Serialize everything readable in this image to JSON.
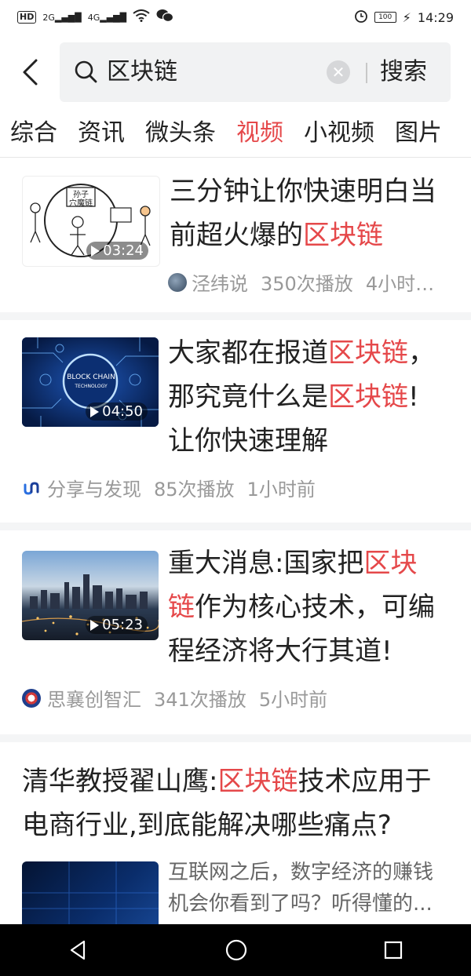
{
  "status_bar": {
    "hd": "HD",
    "net1": "2G",
    "net2": "4G",
    "battery": "100",
    "time": "14:29"
  },
  "search": {
    "query": "区块链",
    "button": "搜索"
  },
  "tabs": [
    {
      "label": "综合"
    },
    {
      "label": "资讯"
    },
    {
      "label": "微头条"
    },
    {
      "label": "视频"
    },
    {
      "label": "小视频"
    },
    {
      "label": "图片"
    }
  ],
  "results": [
    {
      "title_pre": "三分钟让你快速明白当前超火爆的",
      "title_hl": "区块链",
      "duration": "03:24",
      "author": "泾纬说",
      "plays": "350次播放",
      "time": "4小时…",
      "thumb_text": "孙子\n穴魔链"
    },
    {
      "title_pre": "大家都在报道",
      "title_hl": "区块链",
      "title_mid": "，那究竟什么是",
      "title_hl2": "区块链",
      "title_post": "!让你快速理解",
      "duration": "04:50",
      "author": "分享与发现",
      "plays": "85次播放",
      "time": "1小时前",
      "thumb_text": "BLOCK CHAIN",
      "thumb_sub": "TECHNOLOGY"
    },
    {
      "title_pre": "重大消息:国家把",
      "title_hl": "区块链",
      "title_post": "作为核心技术，可编程经济将大行其道!",
      "duration": "05:23",
      "author": "思襄创智汇",
      "plays": "341次播放",
      "time": "5小时前"
    },
    {
      "title_pre": "清华教授翟山鹰:",
      "title_hl": "区块链",
      "title_post": "技术应用于电商行业,到底能解决哪些痛点?",
      "desc": "互联网之后，数字经济的赚钱机会你看到了吗？听得懂的..."
    }
  ],
  "colors": {
    "accent": "#e5484a",
    "meta": "#999999",
    "separator": "#f4f5f6"
  }
}
